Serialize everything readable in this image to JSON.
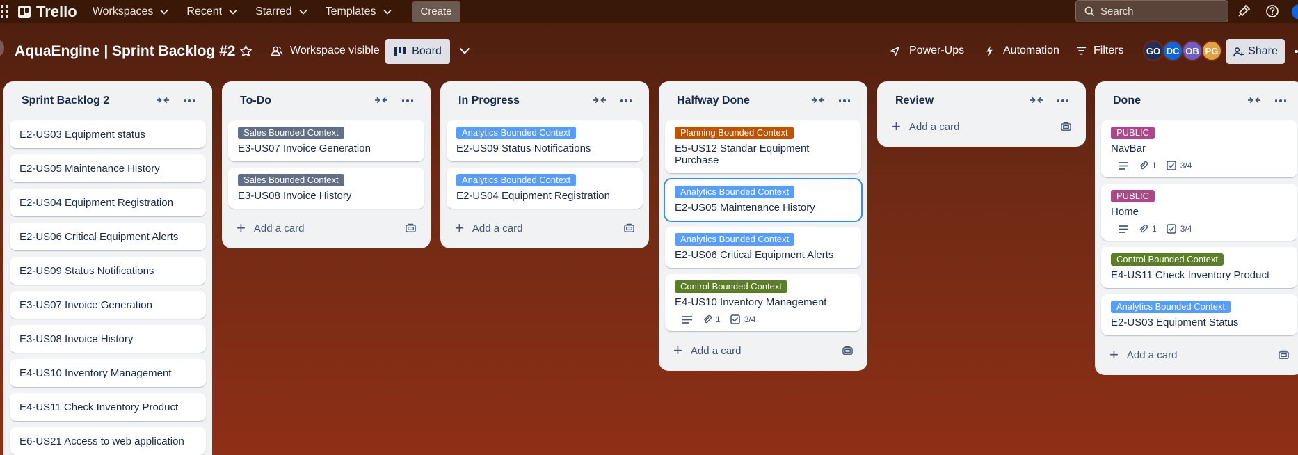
{
  "app": {
    "name": "Trello",
    "nav": [
      "Workspaces",
      "Recent",
      "Starred",
      "Templates"
    ],
    "create_label": "Create",
    "search_placeholder": "Search"
  },
  "board": {
    "title": "AquaEngine | Sprint Backlog #2",
    "visibility": "Workspace visible",
    "view_label": "Board",
    "powerups_label": "Power-Ups",
    "automation_label": "Automation",
    "filters_label": "Filters",
    "share_label": "Share",
    "members": [
      {
        "initials": "GO",
        "color": "#1f2f57"
      },
      {
        "initials": "DC",
        "color": "#0c66e4"
      },
      {
        "initials": "OB",
        "color": "#6e5dc6"
      },
      {
        "initials": "PG",
        "color": "#e2a03f"
      }
    ]
  },
  "label_colors": {
    "sales": "#626f86",
    "analytics": "#579dff",
    "planning": "#c25100",
    "control": "#5b7f24",
    "public": "#ae4787"
  },
  "add_card_label": "Add a card",
  "lists": [
    {
      "title": "Sprint Backlog 2",
      "cards": [
        {
          "title": "E2-US03 Equipment status"
        },
        {
          "title": "E2-US05 Maintenance History"
        },
        {
          "title": "E2-US04 Equipment Registration"
        },
        {
          "title": "E2-US06 Critical Equipment Alerts"
        },
        {
          "title": "E2-US09 Status Notifications"
        },
        {
          "title": "E3-US07 Invoice Generation"
        },
        {
          "title": "E3-US08 Invoice History"
        },
        {
          "title": "E4-US10 Inventory Management"
        },
        {
          "title": "E4-US11 Check Inventory Product"
        },
        {
          "title": "E6-US21 Access to web application"
        }
      ]
    },
    {
      "title": "To-Do",
      "cards": [
        {
          "label": "Sales Bounded Context",
          "label_color": "#626f86",
          "title": "E3-US07 Invoice Generation"
        },
        {
          "label": "Sales Bounded Context",
          "label_color": "#626f86",
          "title": "E3-US08 Invoice History"
        }
      ]
    },
    {
      "title": "In Progress",
      "cards": [
        {
          "label": "Analytics Bounded Context",
          "label_color": "#579dff",
          "title": "E2-US09 Status Notifications"
        },
        {
          "label": "Analytics Bounded Context",
          "label_color": "#579dff",
          "title": "E2-US04 Equipment Registration"
        }
      ]
    },
    {
      "title": "Halfway Done",
      "cards": [
        {
          "label": "Planning Bounded Context",
          "label_color": "#c25100",
          "title": "E5-US12 Standar Equipment Purchase"
        },
        {
          "label": "Analytics Bounded Context",
          "label_color": "#579dff",
          "title": "E2-US05 Maintenance History",
          "selected": true
        },
        {
          "label": "Analytics Bounded Context",
          "label_color": "#579dff",
          "title": "E2-US06 Critical Equipment Alerts"
        },
        {
          "label": "Control Bounded Context",
          "label_color": "#5b7f24",
          "title": "E4-US10 Inventory Management",
          "badges": {
            "attachments": "1",
            "checklist": "3/4"
          }
        }
      ]
    },
    {
      "title": "Review",
      "cards": []
    },
    {
      "title": "Done",
      "cards": [
        {
          "label": "PUBLIC",
          "label_color": "#ae4787",
          "title": "NavBar",
          "badges": {
            "attachments": "1",
            "checklist": "3/4"
          }
        },
        {
          "label": "PUBLIC",
          "label_color": "#ae4787",
          "title": "Home",
          "badges": {
            "attachments": "1",
            "checklist": "3/4"
          }
        },
        {
          "label": "Control Bounded Context",
          "label_color": "#5b7f24",
          "title": "E4-US11 Check Inventory Product"
        },
        {
          "label": "Analytics Bounded Context",
          "label_color": "#579dff",
          "title": "E2-US03 Equipment Status"
        }
      ]
    }
  ]
}
